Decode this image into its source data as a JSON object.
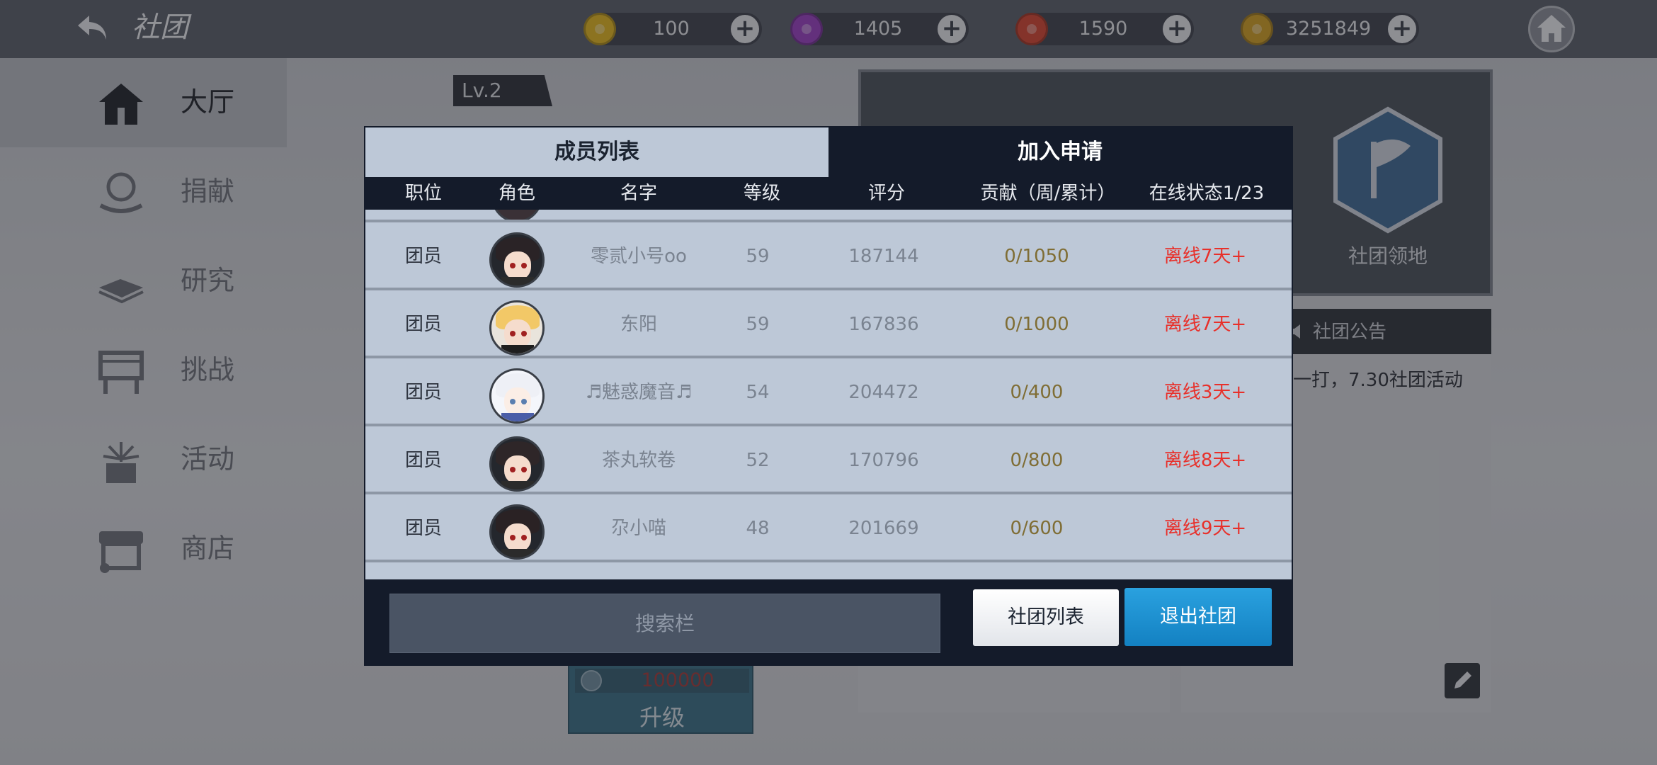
{
  "header": {
    "title": "社团",
    "currencies": [
      {
        "value": "100",
        "color": "#e6b81c",
        "icon": "gold-token-icon"
      },
      {
        "value": "1405",
        "color": "#9b3fc4",
        "icon": "purple-gem-icon"
      },
      {
        "value": "1590",
        "color": "#d8442e",
        "icon": "red-gem-icon"
      },
      {
        "value": "3251849",
        "color": "#d4a020",
        "icon": "gold-coin-icon"
      }
    ]
  },
  "sidebar": {
    "items": [
      {
        "label": "大厅",
        "icon": "hall-icon",
        "active": true
      },
      {
        "label": "捐献",
        "icon": "donate-icon"
      },
      {
        "label": "研究",
        "icon": "research-book-icon"
      },
      {
        "label": "挑战",
        "icon": "challenge-board-icon"
      },
      {
        "label": "活动",
        "icon": "event-gift-icon"
      },
      {
        "label": "商店",
        "icon": "shop-icon"
      }
    ]
  },
  "background": {
    "level": "Lv.2",
    "territory_label": "社团领地",
    "notice_title": "社团公告",
    "notice_text": "一打，7.30社团活动",
    "upgrade_cost": "100000",
    "upgrade_label": "升级"
  },
  "modal": {
    "tabs": [
      "成员列表",
      "加入申请"
    ],
    "columns": [
      "职位",
      "角色",
      "名字",
      "等级",
      "评分",
      "贡献（周/累计）",
      "在线状态1/23"
    ],
    "rows": [
      {
        "role": "团员",
        "name": "零贰小号oo",
        "level": "59",
        "score": "187144",
        "contribution": "0/1050",
        "status": "离线7天+",
        "hair": "#2a2326"
      },
      {
        "role": "团员",
        "name": "东阳",
        "level": "59",
        "score": "167836",
        "contribution": "0/1000",
        "status": "离线7天+",
        "hair": "#f2c867"
      },
      {
        "role": "团员",
        "name": "♬魅惑魔音♬",
        "level": "54",
        "score": "204472",
        "contribution": "0/400",
        "status": "离线3天+",
        "hair": "#eef0f6"
      },
      {
        "role": "团员",
        "name": "茶丸软卷",
        "level": "52",
        "score": "170796",
        "contribution": "0/800",
        "status": "离线8天+",
        "hair": "#2e2628"
      },
      {
        "role": "团员",
        "name": "尕小喵",
        "level": "48",
        "score": "201669",
        "contribution": "0/600",
        "status": "离线9天+",
        "hair": "#2a2224"
      }
    ],
    "search_placeholder": "搜索栏",
    "buttons": {
      "club_list": "社团列表",
      "exit_club": "退出社团"
    }
  }
}
